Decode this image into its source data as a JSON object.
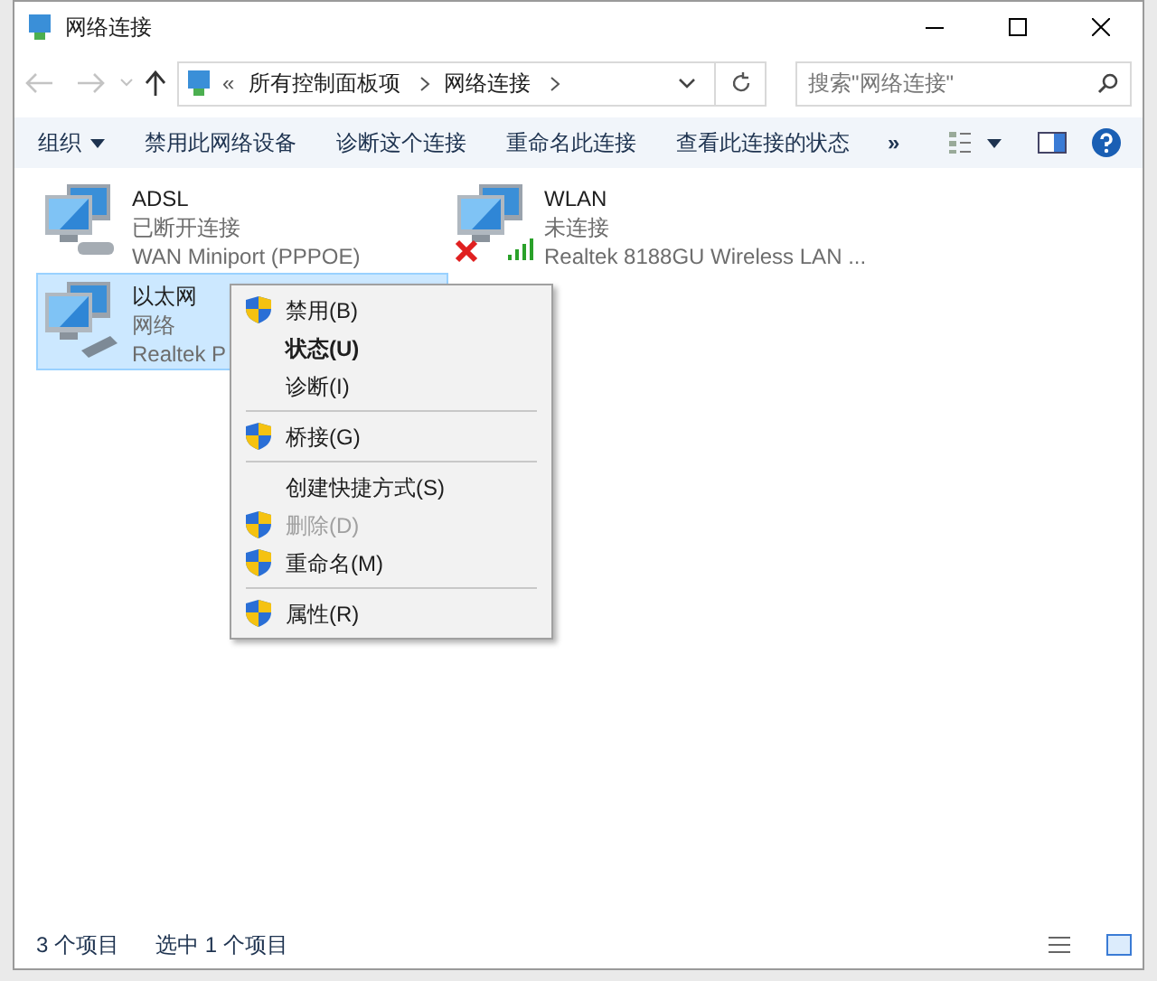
{
  "window": {
    "title": "网络连接"
  },
  "address": {
    "overflow": "«",
    "path": [
      "所有控制面板项",
      "网络连接"
    ]
  },
  "search": {
    "placeholder": "搜索\"网络连接\""
  },
  "toolbar": {
    "items": [
      "组织",
      "禁用此网络设备",
      "诊断这个连接",
      "重命名此连接",
      "查看此连接的状态"
    ],
    "more": "»"
  },
  "connections": [
    {
      "name": "ADSL",
      "status": "已断开连接",
      "device": "WAN Miniport (PPPOE)",
      "kind": "modem",
      "selected": false
    },
    {
      "name": "WLAN",
      "status": "未连接",
      "device": "Realtek 8188GU Wireless LAN ...",
      "kind": "wireless",
      "selected": false
    },
    {
      "name": "以太网",
      "status": "网络",
      "device": "Realtek P",
      "kind": "ethernet",
      "selected": true
    }
  ],
  "context_menu": {
    "groups": [
      [
        {
          "label": "禁用(B)",
          "shield": true,
          "default": false,
          "disabled": false
        },
        {
          "label": "状态(U)",
          "shield": false,
          "default": true,
          "disabled": false
        },
        {
          "label": "诊断(I)",
          "shield": false,
          "default": false,
          "disabled": false
        }
      ],
      [
        {
          "label": "桥接(G)",
          "shield": true,
          "default": false,
          "disabled": false
        }
      ],
      [
        {
          "label": "创建快捷方式(S)",
          "shield": false,
          "default": false,
          "disabled": false
        },
        {
          "label": "删除(D)",
          "shield": true,
          "default": false,
          "disabled": true
        },
        {
          "label": "重命名(M)",
          "shield": true,
          "default": false,
          "disabled": false
        }
      ],
      [
        {
          "label": "属性(R)",
          "shield": true,
          "default": false,
          "disabled": false
        }
      ]
    ]
  },
  "status_bar": {
    "count": "3 个项目",
    "selection": "选中 1 个项目"
  }
}
